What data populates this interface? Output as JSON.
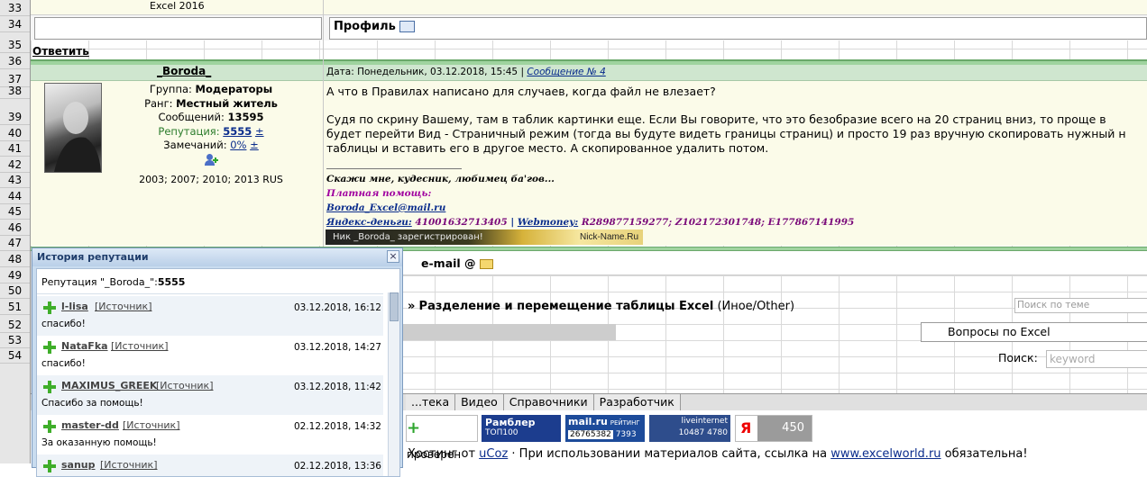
{
  "rows": [
    "33",
    "34",
    "35",
    "36",
    "37",
    "38",
    "39",
    "40",
    "41",
    "42",
    "43",
    "44",
    "45",
    "46",
    "47",
    "48",
    "49",
    "50",
    "51",
    "52",
    "53",
    "54"
  ],
  "top_cell_text": "Excel 2016",
  "profile": {
    "label": "Профиль"
  },
  "reply_link": "Ответить",
  "user": {
    "name": "_Boroda_",
    "group_label": "Группа:",
    "group": "Модераторы",
    "rank_label": "Ранг:",
    "rank": "Местный житель",
    "messages_label": "Сообщений:",
    "messages": "13595",
    "reputation_label": "Репутация:",
    "reputation": "5555",
    "reputation_pm": "±",
    "remarks_label": "Замечаний:",
    "remarks": "0%",
    "remarks_pm": "±",
    "versions": "2003; 2007; 2010; 2013 RUS"
  },
  "post": {
    "date_label": "Дата: Понедельник, 03.12.2018, 15:45",
    "sep": "|",
    "message_link": "Сообщение № 4",
    "line1": "А что в Правилах написано для случаев, когда файл не влезает?",
    "line2": "Судя по скрину Вашему, там в таблик картинки еще. Если Вы говорите, что это безобразие всего на 20 страниц вниз, то проще в",
    "line3": "будет перейти Вид - Страничный режим (тогда вы будуте видеть границы страниц) и просто 19 раз вручную скопировать нужный н",
    "line4": "таблицы и вставить его в другое место. А скопированное удалить потом.",
    "sig1": "Скажи мне, кудесник, любимец ба'гов...",
    "sig2": "Платная помощь:",
    "sig3": "Boroda_Excel@mail.ru",
    "sig4_label": "Яндекс-деньги:",
    "sig4_value": "41001632713405",
    "sig4_sep": "|",
    "sig4_label2": "Webmoney:",
    "sig4_value2": "R289877159277; Z102172301748; E177867141995",
    "nick_banner": "Ник _Boroda_ зарегистрирован!",
    "nick_site": "Nick-Name.Ru"
  },
  "email_label": "e-mail",
  "thread": {
    "prefix": "»",
    "title": "Разделение и перемещение таблицы Excel",
    "category": "(Иное/Other)"
  },
  "search_topic_placeholder": "Поиск по теме",
  "forum_select": "Вопросы по Excel",
  "search_label": "Поиск:",
  "search_placeholder": "keyword",
  "tabs": [
    "...тека",
    "Видео",
    "Справочники",
    "Разработчик"
  ],
  "badges": {
    "proveren": "проверен",
    "rambler": "Рамблер",
    "rambler_sub": "ТОП100",
    "mailru": "mail.ru",
    "mail_sub": "РЕЙТИНГ",
    "mail_num": "26765382",
    "mail_n1": "7393",
    "mail_n2": "3464",
    "li": "liveinternet",
    "li_n1": "10487",
    "li_n2": "4780",
    "ya_count": "450"
  },
  "footer": {
    "pre": "Хостинг от",
    "ucoz": "uCoz",
    "mid": "· При использовании материалов сайта, ссылка на",
    "site": "www.excelworld.ru",
    "post": "обязательна!"
  },
  "popup": {
    "title": "История репутации",
    "subtitle": "Репутация \"_Boroda_\":",
    "subtitle_value": "5555",
    "source": "[Источник]",
    "entries": [
      {
        "user": "l-lisa",
        "date": "03.12.2018, 16:12",
        "text": "спасибо!"
      },
      {
        "user": "NataFka",
        "date": "03.12.2018, 14:27",
        "text": "спасибо!"
      },
      {
        "user": "MAXIMUS_GREEK",
        "date": "03.12.2018, 11:42",
        "text": "Спасибо за помощь!"
      },
      {
        "user": "master-dd",
        "date": "02.12.2018, 14:32",
        "text": "За оказанную помощь!"
      },
      {
        "user": "sanup",
        "date": "02.12.2018, 13:36",
        "text": ""
      }
    ]
  },
  "colors": {
    "header_green": "#9fd39f",
    "cream": "#fbfbe9",
    "link": "#0a2c8c",
    "popup_blue": "#c9dcef"
  },
  "icons": [
    "profile-card-icon",
    "add-friend-icon",
    "email-icon",
    "close-icon",
    "plus-icon"
  ]
}
